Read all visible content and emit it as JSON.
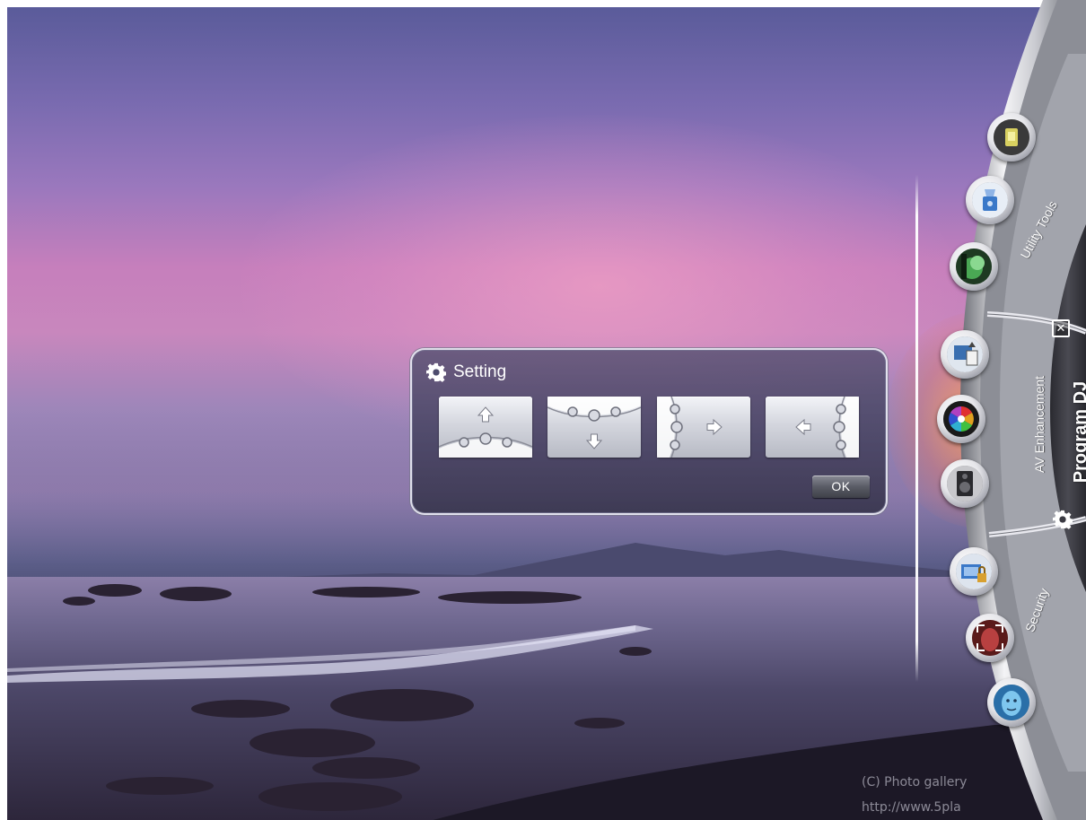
{
  "wallpaper": {
    "watermark_lines": [
      "(C) Photo gallery",
      "http://www.5pla"
    ]
  },
  "setting_dialog": {
    "title": "Setting",
    "title_icon": "gear-icon",
    "position_buttons": [
      {
        "name": "dock-top",
        "arrow": "up"
      },
      {
        "name": "dock-bottom",
        "arrow": "down"
      },
      {
        "name": "dock-left",
        "arrow": "right"
      },
      {
        "name": "dock-right",
        "arrow": "left"
      }
    ],
    "ok_label": "OK"
  },
  "dock": {
    "title": "Program DJ",
    "close_glyph": "✕",
    "groups": [
      {
        "label": "Utility Tools",
        "icons": [
          "flashlight-icon",
          "cleaner-icon",
          "monitor-icon"
        ]
      },
      {
        "label": "AV Enhancement",
        "icons": [
          "display-icon",
          "color-wheel-icon",
          "speaker-icon"
        ]
      },
      {
        "label": "Security",
        "icons": [
          "lock-folder-icon",
          "face-scan-icon",
          "face-id-icon"
        ]
      }
    ],
    "settings_icon": "gear-icon"
  }
}
